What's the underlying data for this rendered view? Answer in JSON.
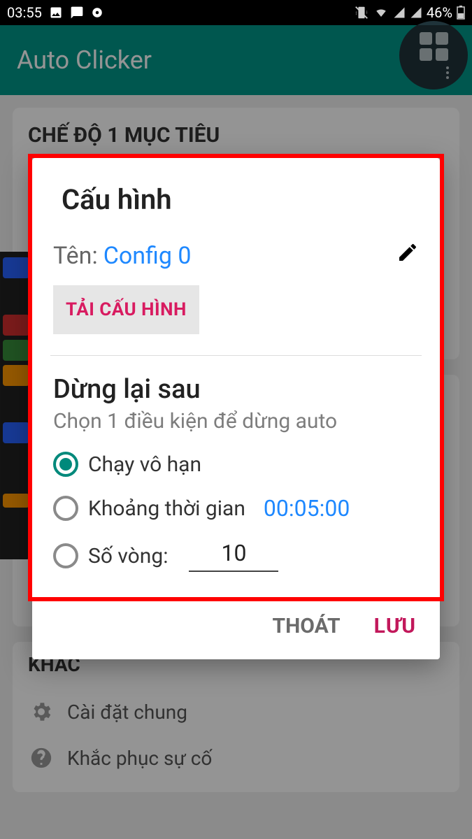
{
  "status": {
    "time": "03:55",
    "battery": "46%"
  },
  "app_bar": {
    "title": "Auto Clicker"
  },
  "bg": {
    "card1_title": "CHẾ ĐỘ 1 MỤC TIÊU",
    "khac": "KHÁC",
    "settings": "Cài đặt chung",
    "troubleshoot": "Khắc phục sự cố"
  },
  "dialog": {
    "title": "Cấu hình",
    "name_label": "Tên:",
    "name_value": "Config 0",
    "load_btn": "TẢI CẤU HÌNH",
    "stop_title": "Dừng lại sau",
    "stop_sub": "Chọn 1 điều kiện để dừng auto",
    "opt_infinite": "Chạy vô hạn",
    "opt_duration": "Khoảng thời gian",
    "duration_value": "00:05:00",
    "opt_cycles": "Số vòng:",
    "cycles_value": "10",
    "exit": "THOÁT",
    "save": "LƯU"
  }
}
